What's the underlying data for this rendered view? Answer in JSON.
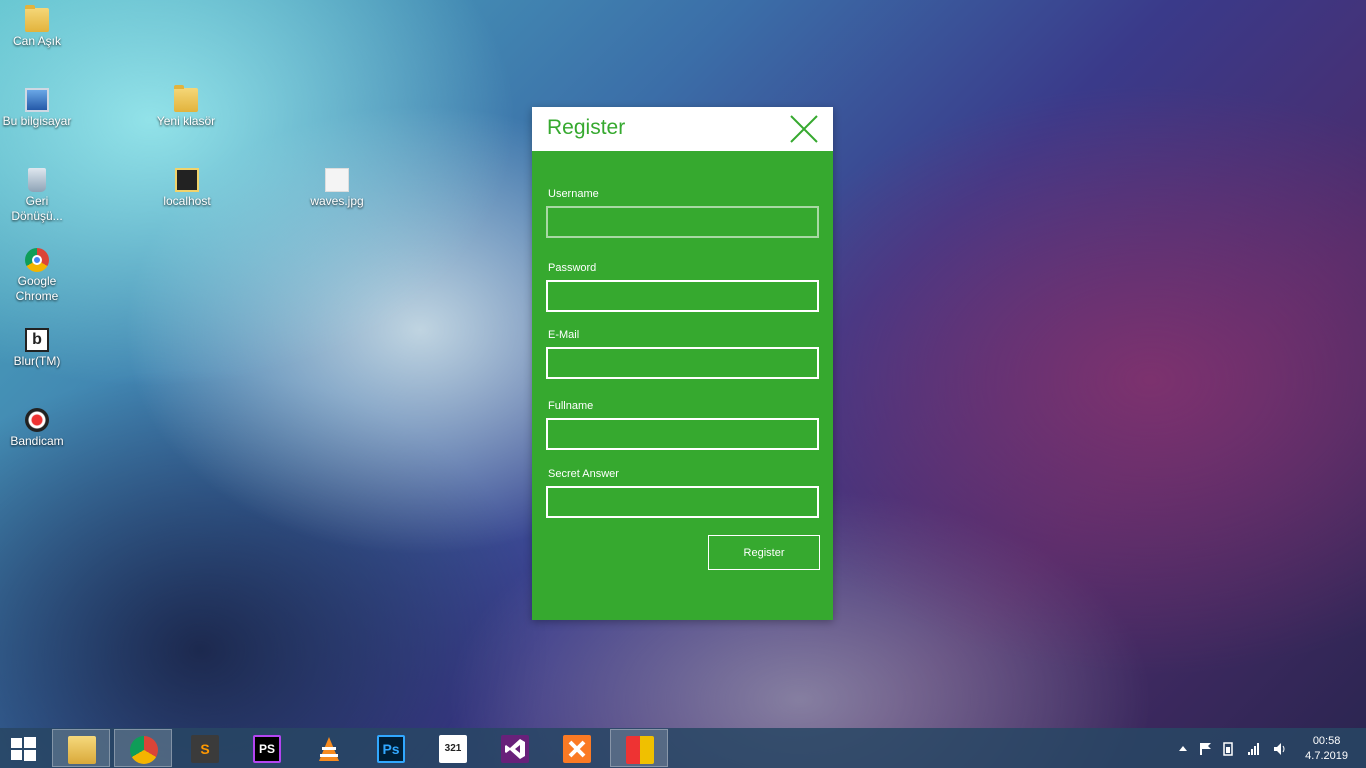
{
  "desktop": {
    "icons": [
      {
        "label": "Can Aşık",
        "icon": "user-folder-icon"
      },
      {
        "label": "Bu bilgisayar",
        "icon": "computer-icon"
      },
      {
        "label": "Yeni klasör",
        "icon": "folder-icon"
      },
      {
        "label": "Geri Dönüşü...",
        "icon": "recycle-bin-icon"
      },
      {
        "label": "localhost",
        "icon": "shortcut-icon"
      },
      {
        "label": "waves.jpg",
        "icon": "image-file-icon"
      },
      {
        "label": "Google Chrome",
        "icon": "chrome-icon"
      },
      {
        "label": "Blur(TM)",
        "icon": "blur-app-icon"
      },
      {
        "label": "Bandicam",
        "icon": "bandicam-icon"
      }
    ]
  },
  "dialog": {
    "title": "Register",
    "accent_color": "#36a92f",
    "fields": [
      {
        "label": "Username",
        "value": ""
      },
      {
        "label": "Password",
        "value": ""
      },
      {
        "label": "E-Mail",
        "value": ""
      },
      {
        "label": "Fullname",
        "value": ""
      },
      {
        "label": "Secret Answer",
        "value": ""
      }
    ],
    "submit_label": "Register"
  },
  "taskbar": {
    "apps": [
      {
        "name": "file-explorer",
        "glyph": ""
      },
      {
        "name": "chrome",
        "glyph": ""
      },
      {
        "name": "sublime-text",
        "glyph": "S"
      },
      {
        "name": "phpstorm",
        "glyph": "PS"
      },
      {
        "name": "vlc",
        "glyph": ""
      },
      {
        "name": "photoshop",
        "glyph": "Ps"
      },
      {
        "name": "media-player-classic",
        "glyph": "321"
      },
      {
        "name": "visual-studio",
        "glyph": ""
      },
      {
        "name": "xampp",
        "glyph": ""
      },
      {
        "name": "winforms-app",
        "glyph": ""
      }
    ],
    "clock_time": "00:58",
    "clock_date": "4.7.2019"
  }
}
